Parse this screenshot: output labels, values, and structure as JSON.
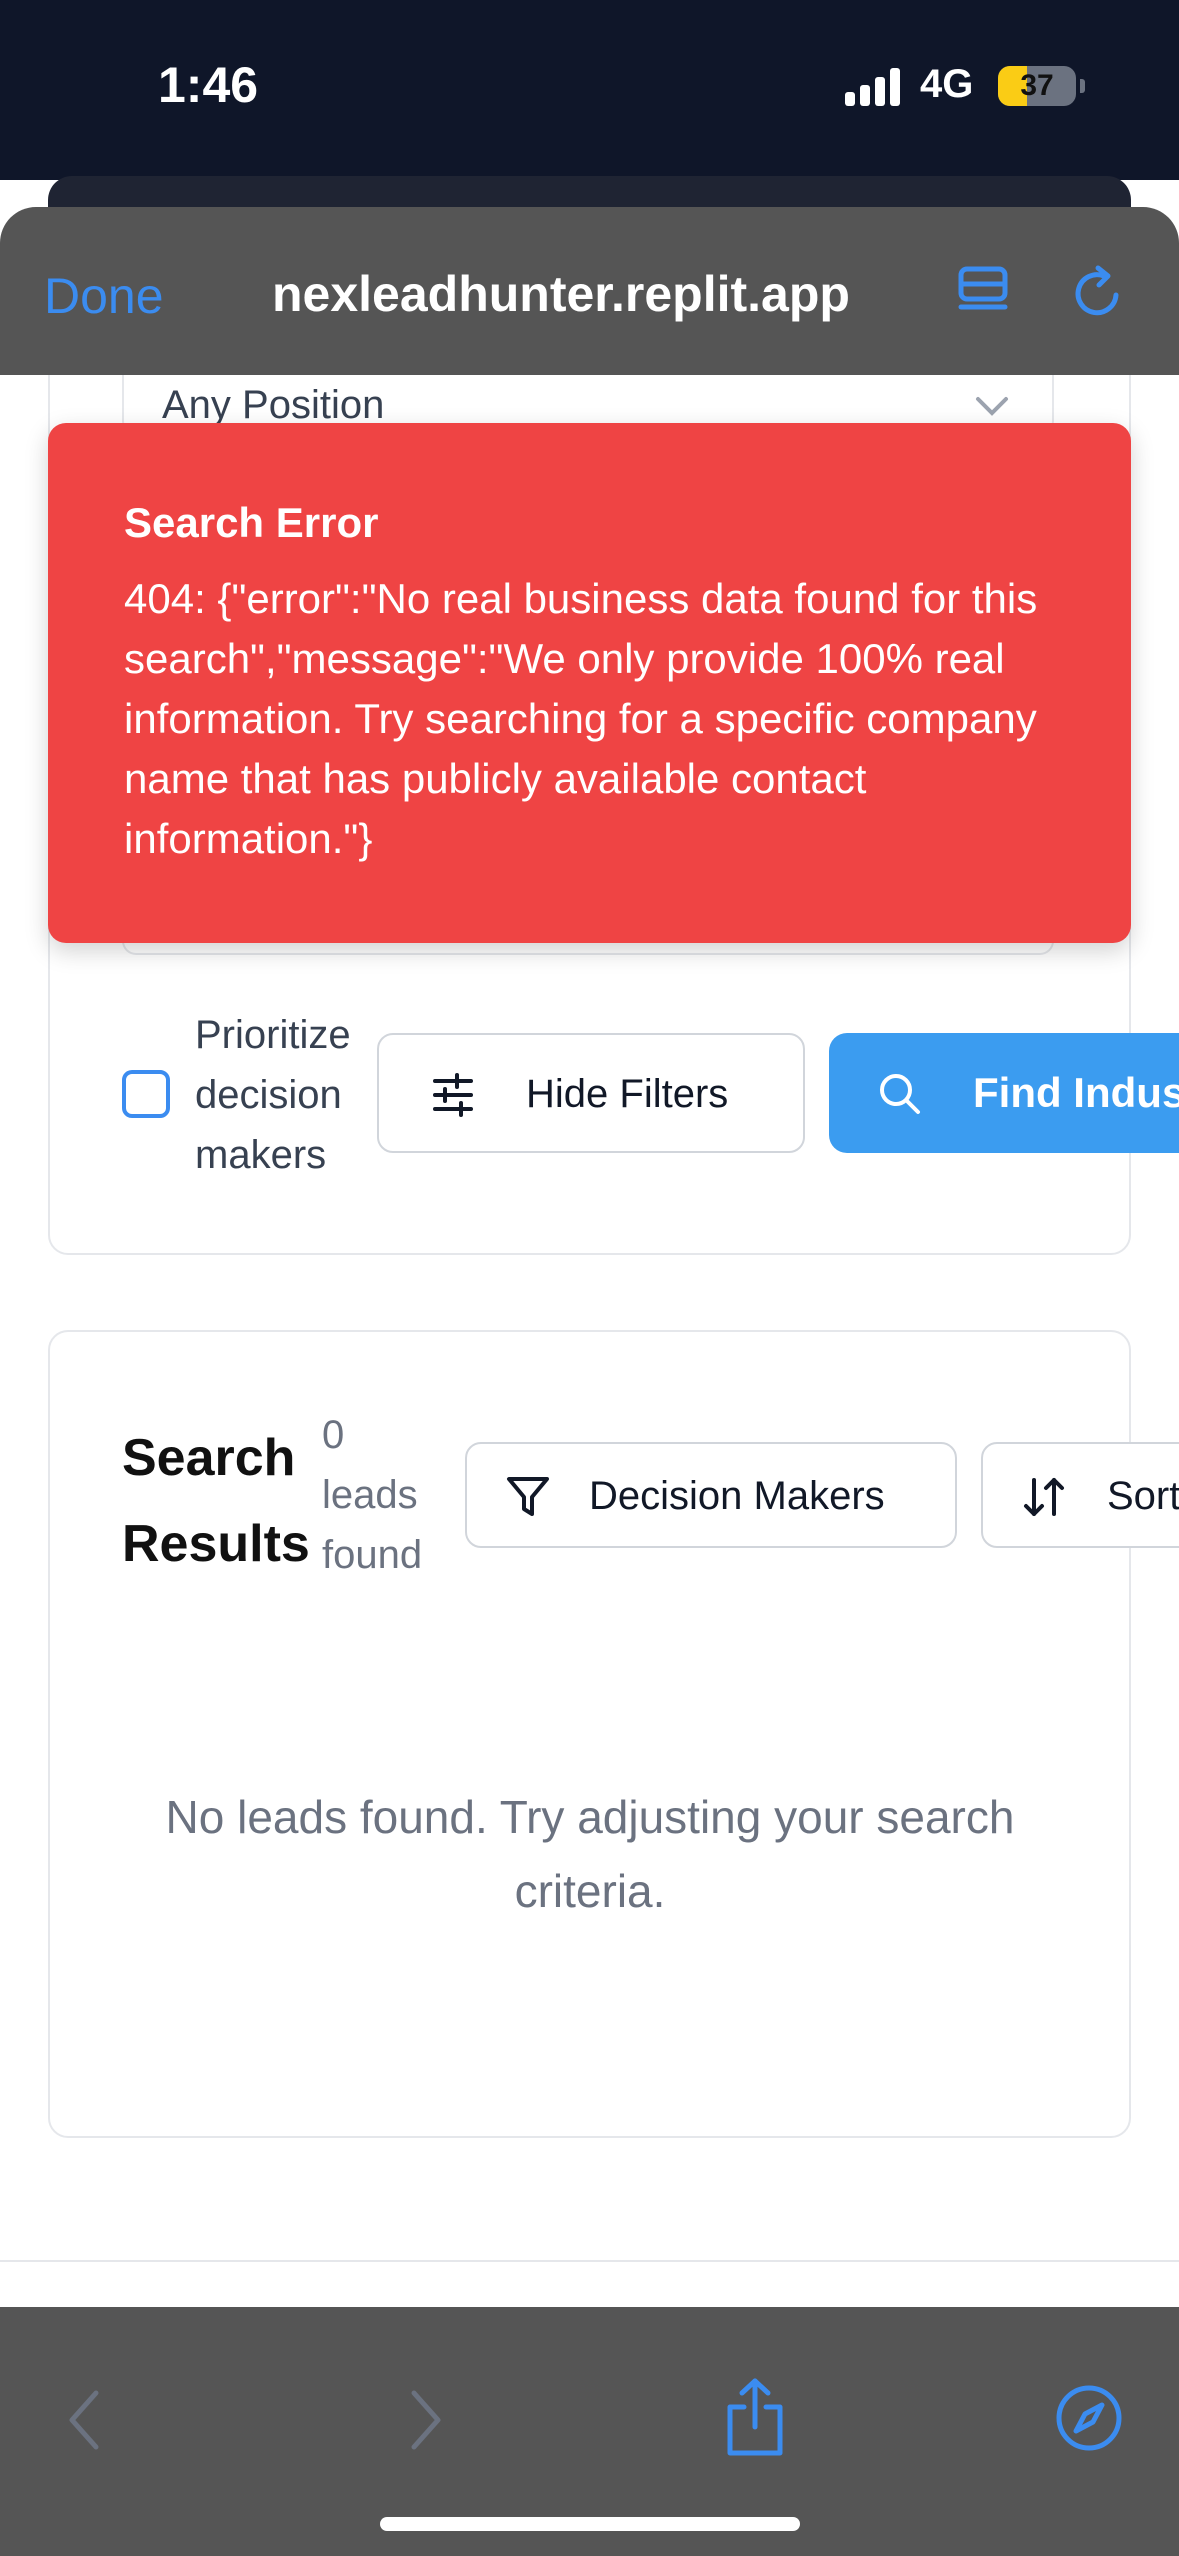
{
  "status_bar": {
    "time": "1:46",
    "network": "4G",
    "battery": "37",
    "battery_level": 0.37
  },
  "browser": {
    "done_label": "Done",
    "url": "nexleadhunter.replit.app"
  },
  "filters": {
    "position_select": "Any Position",
    "prioritize_label": "Prioritize decision makers",
    "prioritize_checked": false,
    "hide_filters_label": "Hide Filters",
    "find_button_label": "Find Indus"
  },
  "results": {
    "title": "Search Results",
    "count_text": "0 leads found",
    "decision_makers_label": "Decision Makers",
    "sort_label": "Sort",
    "empty_message": "No leads found. Try adjusting your search criteria."
  },
  "toast": {
    "title": "Search Error",
    "message": "404: {\"error\":\"No real business data found for this search\",\"message\":\"We only provide 100% real information. Try searching for a specific company name that has publicly available contact information.\"}"
  },
  "colors": {
    "accent": "#3b8cf0",
    "error": "#ef4444",
    "toolbar": "#555555",
    "status_bg": "#0f1629"
  },
  "icons": [
    "signal-icon",
    "battery-icon",
    "reader-icon",
    "reload-icon",
    "chevron-down-icon",
    "sliders-icon",
    "search-icon",
    "filter-icon",
    "sort-icon",
    "back-icon",
    "forward-icon",
    "share-icon",
    "compass-icon"
  ]
}
